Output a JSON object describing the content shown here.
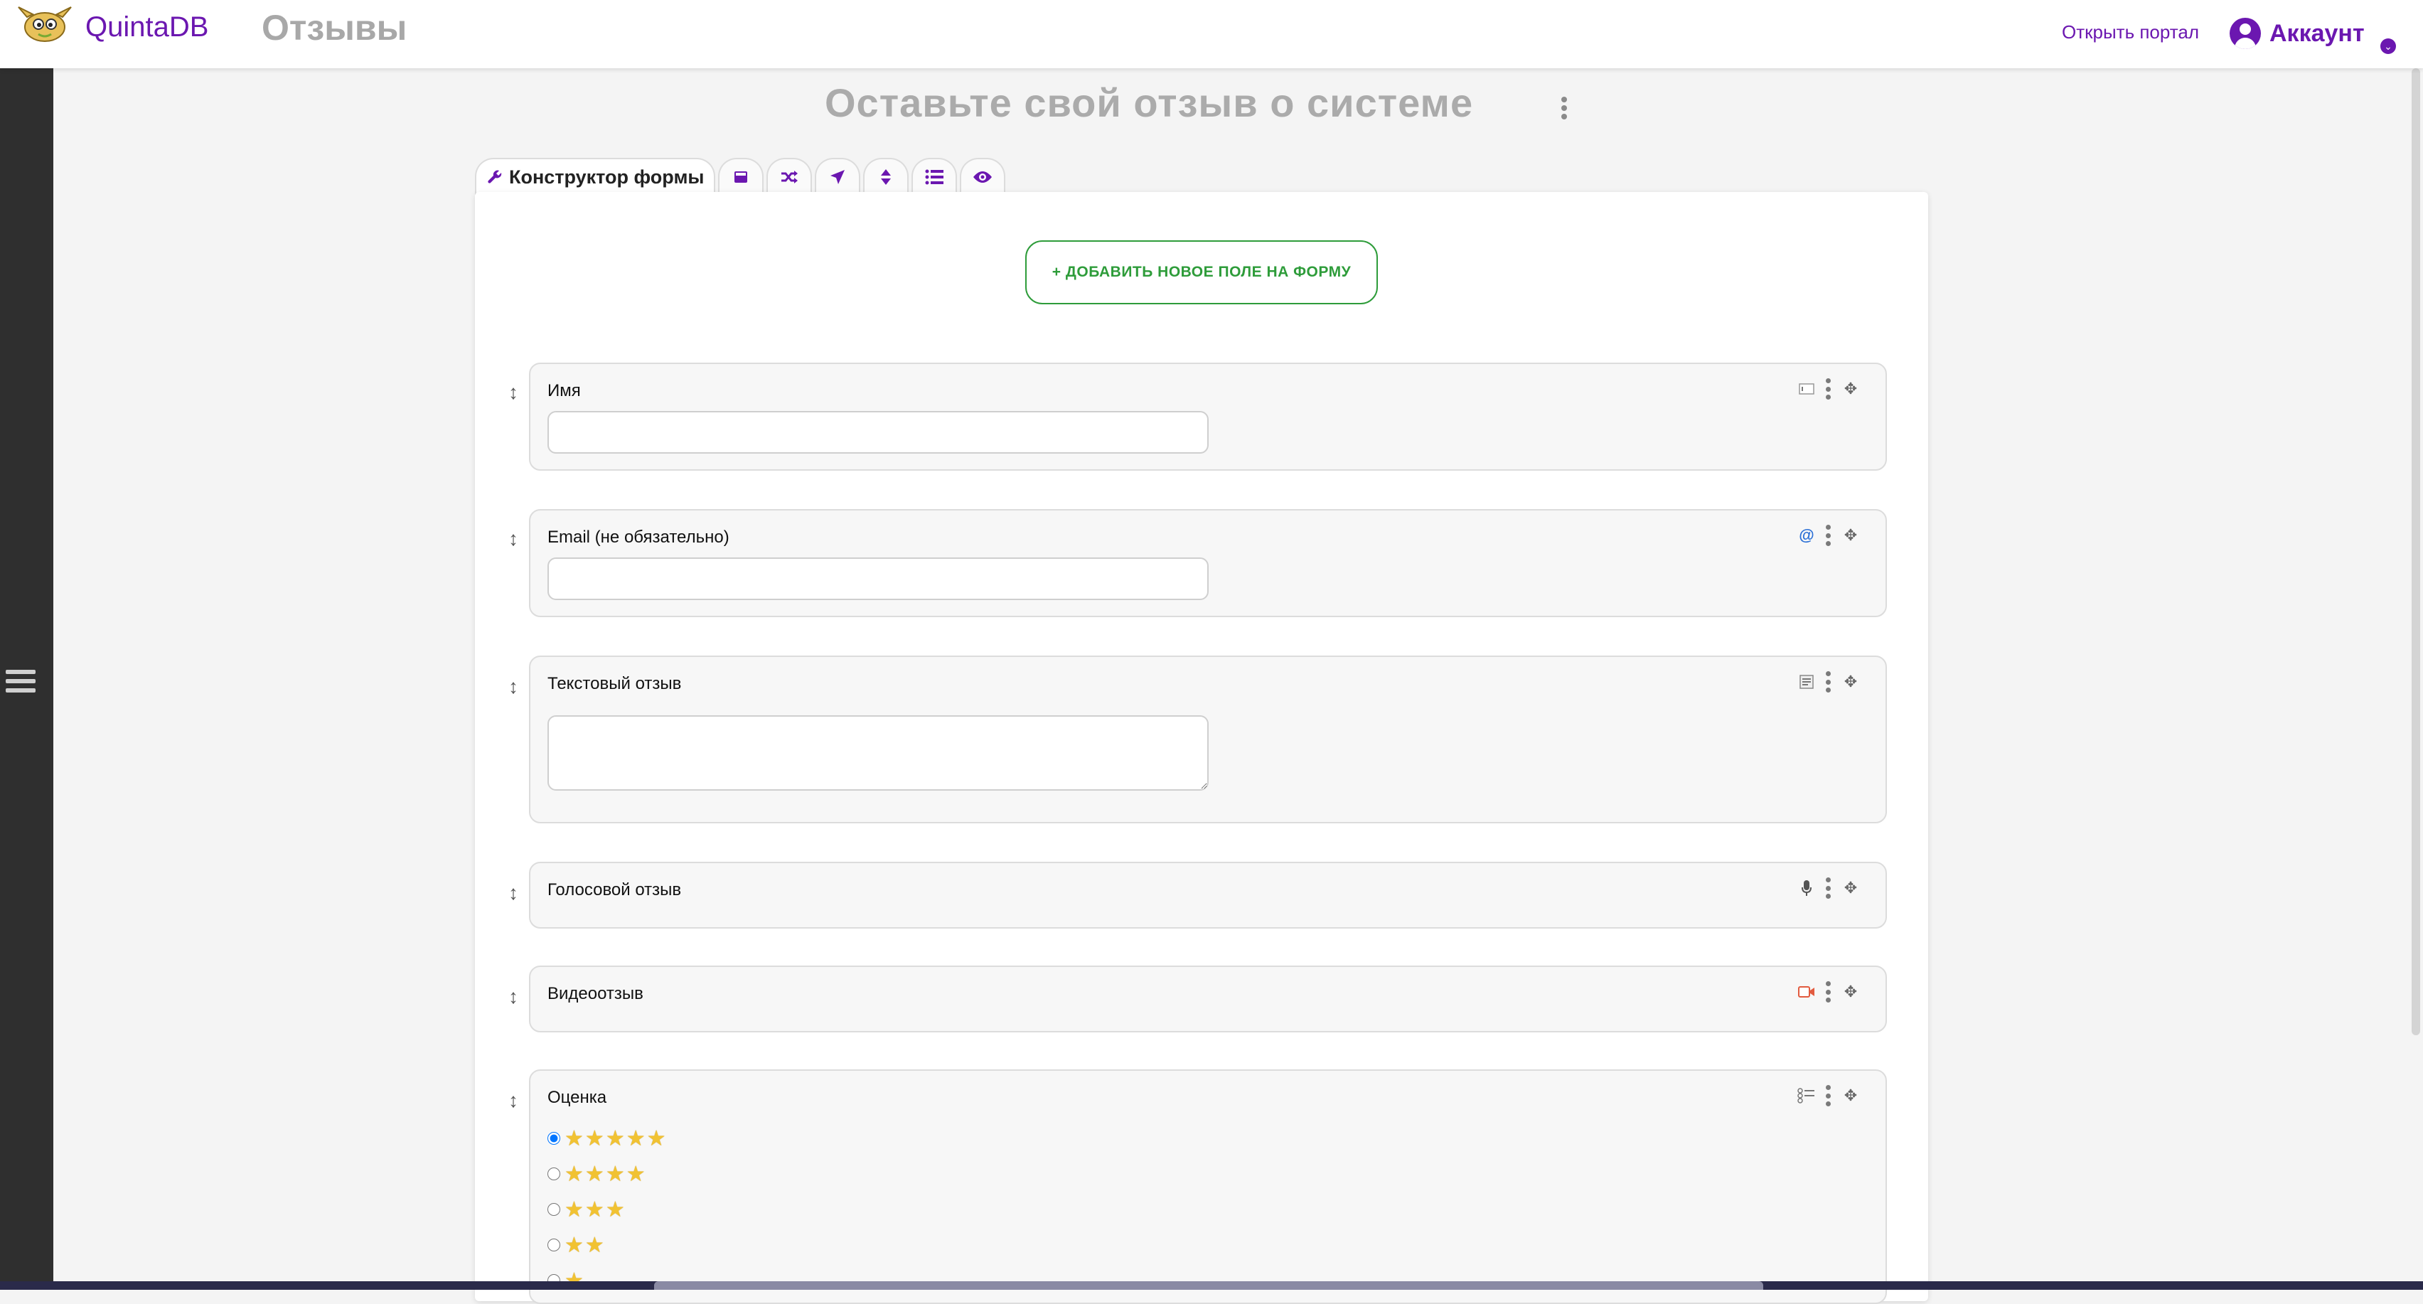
{
  "header": {
    "brand": "QuintaDB",
    "page_name": "Отзывы",
    "portal_link": "Открыть портал",
    "account_label": "Аккаунт"
  },
  "main": {
    "heading": "Оставьте свой отзыв о системе",
    "tabs": [
      {
        "label": "Конструктор формы",
        "icon": "wrench-icon",
        "active": true
      },
      {
        "icon": "calculator-icon"
      },
      {
        "icon": "shuffle-icon"
      },
      {
        "icon": "paper-plane-icon"
      },
      {
        "icon": "sort-icon"
      },
      {
        "icon": "list-icon"
      },
      {
        "icon": "eye-icon"
      }
    ],
    "add_field_button": "+ ДОБАВИТЬ НОВОЕ ПОЛЕ НА ФОРМУ",
    "fields": [
      {
        "label": "Имя",
        "type": "text",
        "type_icon": "text-field-icon",
        "value": ""
      },
      {
        "label": "Email (не обязательно)",
        "type": "email",
        "type_icon": "at-sign-icon",
        "value": ""
      },
      {
        "label": "Текстовый отзыв",
        "type": "textarea",
        "type_icon": "textarea-icon",
        "value": ""
      },
      {
        "label": "Голосовой отзыв",
        "type": "audio",
        "type_icon": "microphone-icon"
      },
      {
        "label": "Видеоотзыв",
        "type": "video",
        "type_icon": "video-camera-icon"
      },
      {
        "label": "Оценка",
        "type": "radio",
        "type_icon": "radio-list-icon",
        "options": [
          {
            "stars": 5,
            "selected": true
          },
          {
            "stars": 4,
            "selected": false
          },
          {
            "stars": 3,
            "selected": false
          },
          {
            "stars": 2,
            "selected": false
          },
          {
            "stars": 1,
            "selected": false
          }
        ]
      }
    ]
  },
  "colors": {
    "brand": "#6b17b0",
    "add_button": "#2e9c3a",
    "heading": "#ababab",
    "sidebar": "#2f2f2f"
  }
}
